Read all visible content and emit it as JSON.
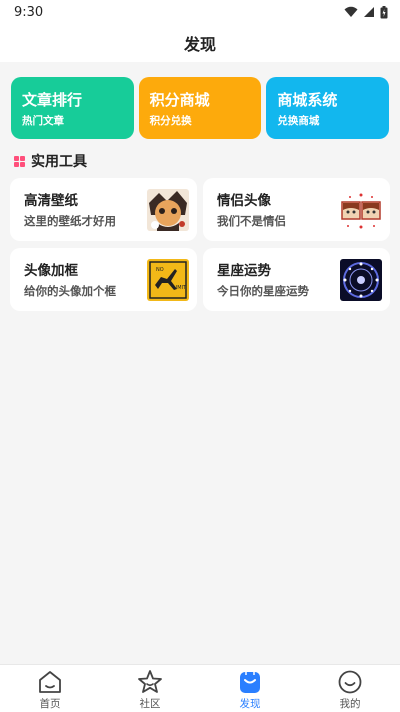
{
  "status_bar": {
    "time": "9:30"
  },
  "header": {
    "title": "发现"
  },
  "banners": [
    {
      "title": "文章排行",
      "subtitle": "热门文章",
      "color": "#17cc99"
    },
    {
      "title": "积分商城",
      "subtitle": "积分兑换",
      "color": "#fdaa0c"
    },
    {
      "title": "商城系统",
      "subtitle": "兑换商城",
      "color": "#12b7ee"
    }
  ],
  "tools_section": {
    "title": "实用工具",
    "icon_color": "#ff4f7b"
  },
  "tools": [
    {
      "title": "高清壁纸",
      "subtitle": "这里的壁纸才好用",
      "thumb": "wallpaper-thumbnail"
    },
    {
      "title": "情侣头像",
      "subtitle": "我们不是情侣",
      "thumb": "couple-avatar-thumbnail"
    },
    {
      "title": "头像加框",
      "subtitle": "给你的头像加个框",
      "thumb": "no-limit-sign-thumbnail",
      "thumb_text": "NO LIMIT"
    },
    {
      "title": "星座运势",
      "subtitle": "今日你的星座运势",
      "thumb": "zodiac-wheel-thumbnail"
    }
  ],
  "tabbar": {
    "active_color": "#2a7fff",
    "items": [
      {
        "label": "首页",
        "icon": "home-icon"
      },
      {
        "label": "社区",
        "icon": "star-icon"
      },
      {
        "label": "发现",
        "icon": "discover-bag-icon",
        "active": true
      },
      {
        "label": "我的",
        "icon": "profile-smile-icon"
      }
    ]
  }
}
